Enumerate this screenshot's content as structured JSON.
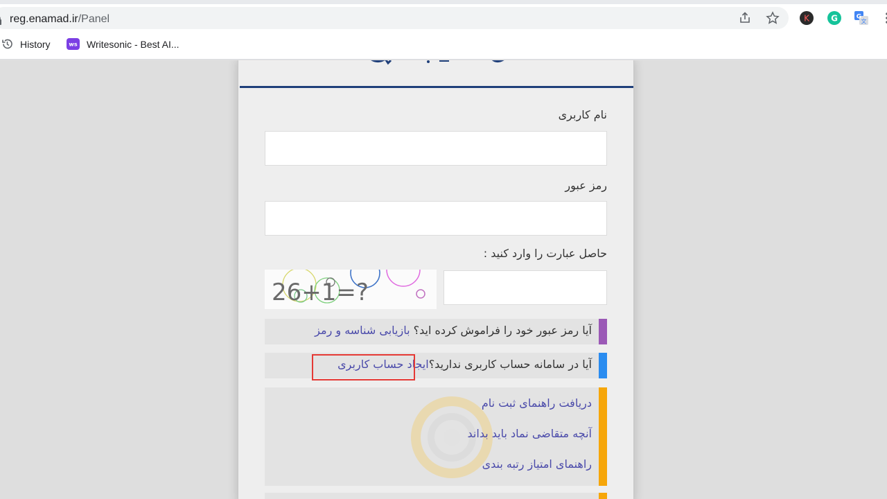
{
  "browser": {
    "url_host": "reg.enamad.ir",
    "url_path": "/Panel",
    "bookmarks": [
      {
        "label": "History",
        "icon": "history-icon"
      },
      {
        "label": "Writesonic - Best AI...",
        "icon": "writesonic-icon",
        "icon_text": "ws"
      }
    ],
    "extensions": [
      {
        "name": "k-extension-icon",
        "text": "K"
      },
      {
        "name": "grammarly-icon",
        "text": "G"
      },
      {
        "name": "google-translate-icon",
        "text": "G"
      }
    ]
  },
  "form": {
    "username_label": "نام کاربری",
    "username_value": "",
    "password_label": "رمز عبور",
    "password_value": "",
    "captcha_label": "حاصل عبارت را وارد کنید :",
    "captcha_text": "26+1=?",
    "captcha_value": ""
  },
  "help": {
    "forgot_question": "آیا رمز عبور خود را فراموش کرده اید؟",
    "forgot_link": "بازیابی شناسه و رمز",
    "no_account_question": "آیا در سامانه حساب کاربری ندارید؟",
    "create_account_link": "ایجاد حساب کاربری",
    "links": [
      "دریافت راهنمای ثبت نام",
      "آنچه متقاضی نماد باید بداند",
      "راهنمای امتیاز رتبه بندی"
    ]
  },
  "colors": {
    "header_line": "#1f3f7a",
    "forgot_bar": "#9b59b6",
    "account_bar": "#2a8cf0",
    "links_bar": "#f6a609",
    "highlight": "#e53935",
    "link_text": "#4a4aaa"
  }
}
